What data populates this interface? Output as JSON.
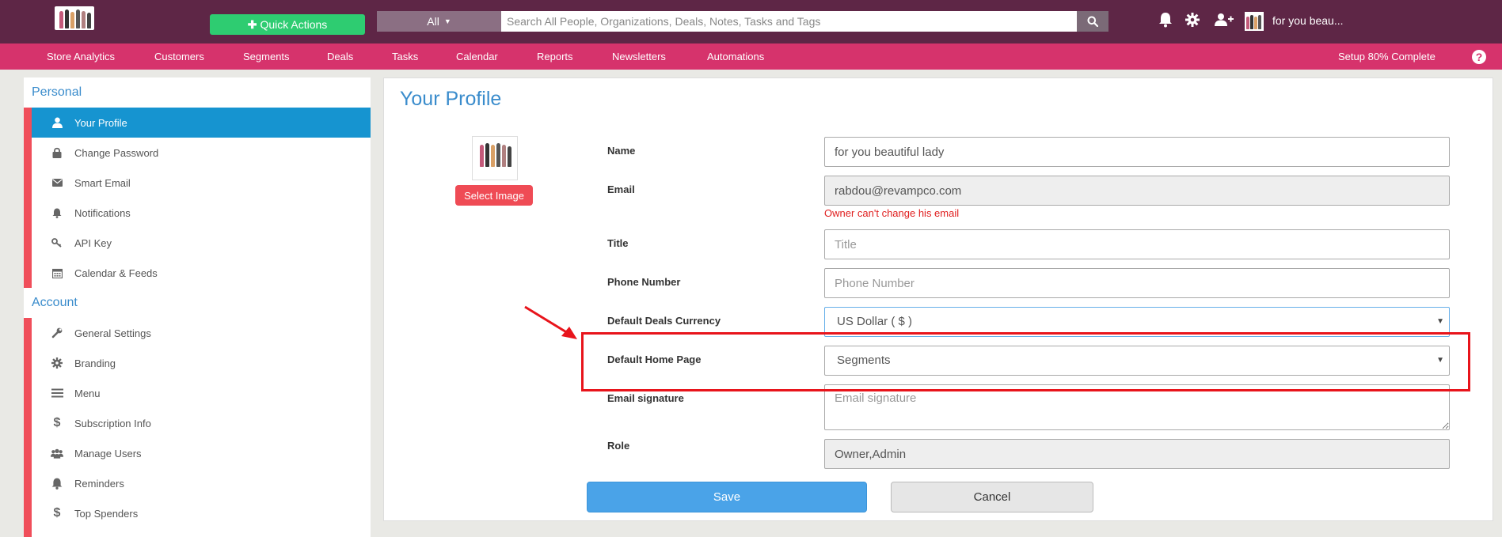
{
  "header": {
    "quick_actions_label": "Quick Actions",
    "search_scope": "All",
    "search_placeholder": "Search All People, Organizations, Deals, Notes, Tasks and Tags",
    "user_name": "for you beau..."
  },
  "nav": {
    "items": [
      "Store Analytics",
      "Customers",
      "Segments",
      "Deals",
      "Tasks",
      "Calendar",
      "Reports",
      "Newsletters",
      "Automations"
    ],
    "setup_status": "Setup 80% Complete",
    "help_label": "?"
  },
  "sidebar": {
    "personal_title": "Personal",
    "personal_items": [
      {
        "label": "Your Profile",
        "icon": "user-icon",
        "active": true
      },
      {
        "label": "Change Password",
        "icon": "lock-icon"
      },
      {
        "label": "Smart Email",
        "icon": "envelope-icon"
      },
      {
        "label": "Notifications",
        "icon": "bell-icon"
      },
      {
        "label": "API Key",
        "icon": "key-icon"
      },
      {
        "label": "Calendar & Feeds",
        "icon": "calendar-icon"
      }
    ],
    "account_title": "Account",
    "account_items": [
      {
        "label": "General Settings",
        "icon": "wrench-icon"
      },
      {
        "label": "Branding",
        "icon": "gear-icon"
      },
      {
        "label": "Menu",
        "icon": "menu-icon"
      },
      {
        "label": "Subscription Info",
        "icon": "dollar-icon"
      },
      {
        "label": "Manage Users",
        "icon": "users-icon"
      },
      {
        "label": "Reminders",
        "icon": "bell-icon"
      },
      {
        "label": "Top Spenders",
        "icon": "dollar-icon"
      }
    ]
  },
  "profile": {
    "title": "Your Profile",
    "select_image_label": "Select Image",
    "name_label": "Name",
    "name_value": "for you beautiful lady",
    "email_label": "Email",
    "email_value": "rabdou@revampco.com",
    "email_note": "Owner can't change his email",
    "title_label": "Title",
    "title_placeholder": "Title",
    "phone_label": "Phone Number",
    "phone_placeholder": "Phone Number",
    "currency_label": "Default Deals Currency",
    "currency_value": "US Dollar ( $ )",
    "home_page_label": "Default Home Page",
    "home_page_value": "Segments",
    "signature_label": "Email signature",
    "signature_placeholder": "Email signature",
    "role_label": "Role",
    "role_value": "Owner,Admin",
    "save_label": "Save",
    "cancel_label": "Cancel"
  },
  "colors": {
    "topbar": "#5e2646",
    "navbar": "#d6336c",
    "quick_actions": "#2ecc71",
    "active_item": "#1694d0",
    "accent_red": "#f04e5a",
    "link_blue": "#3a8ccc",
    "annotation_red": "#e8141b"
  }
}
